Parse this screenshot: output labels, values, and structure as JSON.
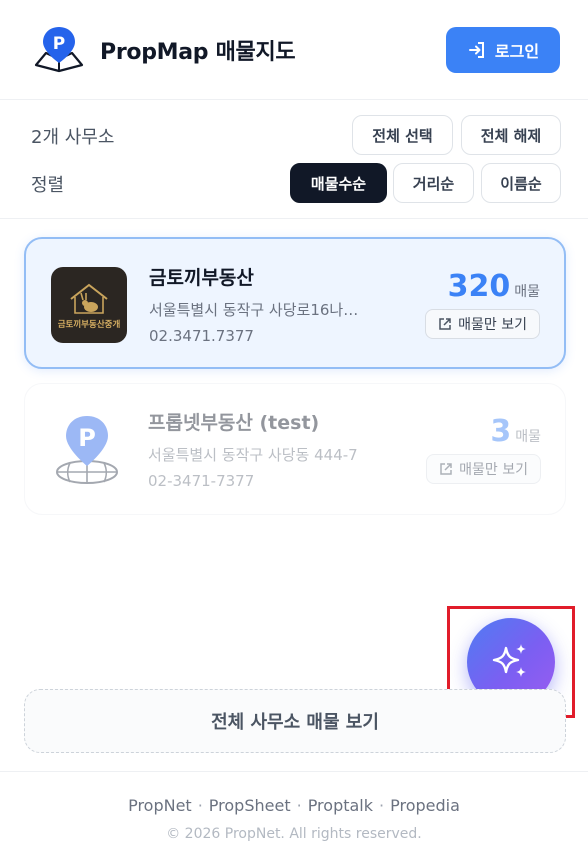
{
  "header": {
    "title": "PropMap 매물지도",
    "login_label": "로그인",
    "logo_icon": "map-pin-book-icon",
    "login_icon": "login-arrow-icon",
    "accent": "#3b82f6"
  },
  "controls": {
    "office_count": "2개 사무소",
    "select_all": "전체 선택",
    "deselect_all": "전체 해제",
    "sort_label": "정렬",
    "sort_options": [
      "매물수순",
      "거리순",
      "이름순"
    ],
    "sort_active": "매물수순"
  },
  "offices": [
    {
      "name": "금토끼부동산",
      "address": "서울특별시 동작구 사당로16나…",
      "phone": "02.3471.7377",
      "listing_count": "320",
      "count_unit": "매물",
      "view_label": "매물만 보기",
      "logo_text": "금토끼부동산중개",
      "selected": true
    },
    {
      "name": "프롭넷부동산 (test)",
      "address": "서울특별시 동작구 사당동 444-7",
      "phone": "02-3471-7377",
      "listing_count": "3",
      "count_unit": "매물",
      "view_label": "매물만 보기",
      "selected": false
    }
  ],
  "ai_fab": {
    "icon": "sparkles-icon"
  },
  "view_all_label": "전체 사무소 매물 보기",
  "footer": {
    "links": [
      "PropNet",
      "PropSheet",
      "Proptalk",
      "Propedia"
    ],
    "copyright": "© 2026 PropNet. All rights reserved."
  }
}
